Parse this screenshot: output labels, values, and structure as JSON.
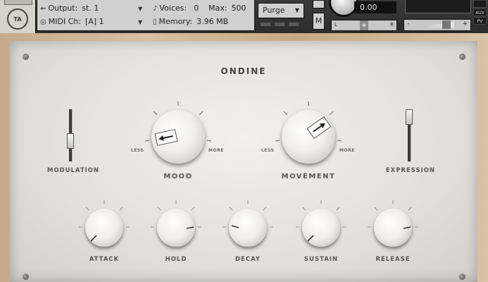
{
  "header": {
    "output_label": "Output:",
    "output_value": "st. 1",
    "voices_label": "Voices:",
    "voices_value": "0",
    "max_label": "Max:",
    "max_value": "500",
    "midi_label": "MIDI Ch:",
    "midi_value": "[A] 1",
    "memory_label": "Memory:",
    "memory_value": "3.96 MB",
    "purge_label": "Purge",
    "m_button": "M",
    "tune_value": "0.00",
    "pan_left": "L",
    "pan_right": "R",
    "vol_minus": "-",
    "vol_plus": "+",
    "side_tabs": [
      "",
      "AUX",
      "PV"
    ],
    "logo_text": "TA"
  },
  "instrument": {
    "title": "ONDINE",
    "modulation": {
      "label": "MODULATION",
      "level": 0.35
    },
    "expression": {
      "label": "EXPRESSION",
      "level": 1.0
    },
    "mood": {
      "label": "MOOD",
      "less": "LESS",
      "more": "MORE"
    },
    "movement": {
      "label": "MOVEMENT",
      "less": "LESS",
      "more": "MORE"
    },
    "envelope": [
      {
        "label": "ATTACK"
      },
      {
        "label": "HOLD"
      },
      {
        "label": "DECAY"
      },
      {
        "label": "SUSTAIN"
      },
      {
        "label": "RELEASE"
      }
    ]
  },
  "colors": {
    "panel": "#e8e6e2",
    "wood": "#d0b494",
    "header": "#2b2b2b",
    "text": "#555555"
  }
}
